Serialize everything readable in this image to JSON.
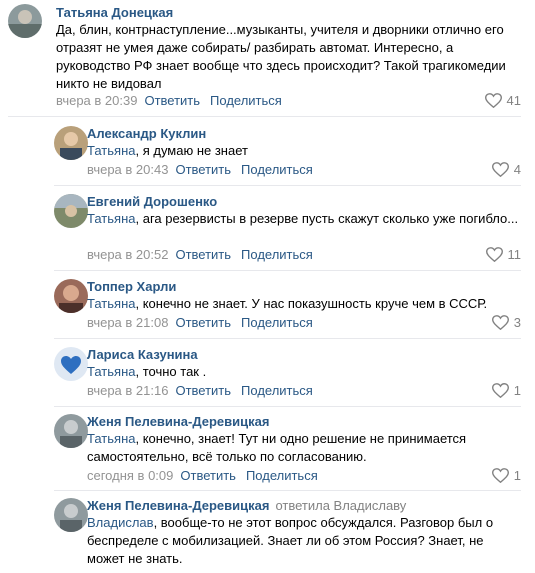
{
  "comments": [
    {
      "author": "Татьяна Донецкая",
      "reply_to": "",
      "text": "Да, блин, контрнаступление...музыканты, учителя и дворники отлично его отразят не умея даже собирать/ разбирать автомат. Интересно, а руководство РФ знает вообще что здесь происходит? Такой трагикомедии никто не видовал",
      "time": "вчера в 20:39",
      "reply_label": "Ответить",
      "share_label": "Поделиться",
      "likes": "41"
    },
    {
      "author": "Александр Куклин",
      "reply_to": "Татьяна",
      "text": ", я думаю не знает",
      "time": "вчера в 20:43",
      "reply_label": "Ответить",
      "share_label": "Поделиться",
      "likes": "4"
    },
    {
      "author": "Евгений Дорошенко",
      "reply_to": "Татьяна",
      "text": ", ага резервисты в резерве пусть скажут сколько уже погибло...",
      "time": "вчера в 20:52",
      "reply_label": "Ответить",
      "share_label": "Поделиться",
      "likes": "11"
    },
    {
      "author": "Топпер Харли",
      "reply_to": "Татьяна",
      "text": ", конечно не знает. У нас показушность круче чем в СССР.",
      "time": "вчера в 21:08",
      "reply_label": "Ответить",
      "share_label": "Поделиться",
      "likes": "3"
    },
    {
      "author": "Лариса Казунина",
      "reply_to": "Татьяна",
      "text": ", точно так .",
      "time": "вчера в 21:16",
      "reply_label": "Ответить",
      "share_label": "Поделиться",
      "likes": "1"
    },
    {
      "author": "Женя Пелевина-Деревицкая",
      "reply_to": "Татьяна",
      "text": ", конечно, знает! Тут ни одно решение не принимается самостоятельно, всё только по согласованию.",
      "time": "сегодня в 0:09",
      "reply_label": "Ответить",
      "share_label": "Поделиться",
      "likes": "1"
    },
    {
      "author": "Женя Пелевина-Деревицкая",
      "author_sub": "ответила Владиславу",
      "reply_to": "Владислав",
      "text": ", вообще-то не этот вопрос обсуждался. Разговор был о беспределе с мобилизацией. Знает ли об этом Россия? Знает, не может не знать."
    }
  ],
  "colors": {
    "link": "#2a5885",
    "meta": "#939393",
    "separator": "#e7e8ec"
  },
  "icons": {
    "like": "heart-outline-icon"
  }
}
